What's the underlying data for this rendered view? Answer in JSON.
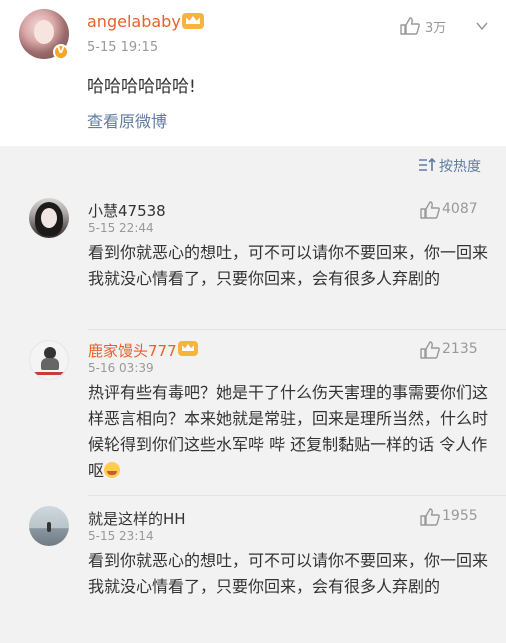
{
  "post": {
    "author": "angelababy",
    "time": "5-15 19:15",
    "likes": "3万",
    "text": "哈哈哈哈哈哈!",
    "view_original": "查看原微博"
  },
  "sort": {
    "label": "按热度"
  },
  "comments": [
    {
      "name": "小慧47538",
      "time": "5-15 22:44",
      "likes": "4087",
      "text": "看到你就恶心的想吐，可不可以请你不要回来，你一回来我就没心情看了，只要你回来，会有很多人弃剧的"
    },
    {
      "name": "鹿家馒头777",
      "time": "5-16 03:39",
      "likes": "2135",
      "text": "热评有些有毒吧？她是干了什么伤天害理的事需要你们这样恶言相向？本来她就是常驻，回来是理所当然，什么时候轮得到你们这些水军哔 哔  还复制黏贴一样的话  令人作呕"
    },
    {
      "name": "就是这样的HH",
      "time": "5-15 23:14",
      "likes": "1955",
      "text": "看到你就恶心的想吐，可不可以请你不要回来，你一回来我就没心情看了，只要你回来，会有很多人弃剧的"
    }
  ],
  "colors": {
    "accent_orange": "#e8612b",
    "link_blue": "#5f7ca3",
    "muted": "#999999",
    "background": "#f2f2f2"
  }
}
